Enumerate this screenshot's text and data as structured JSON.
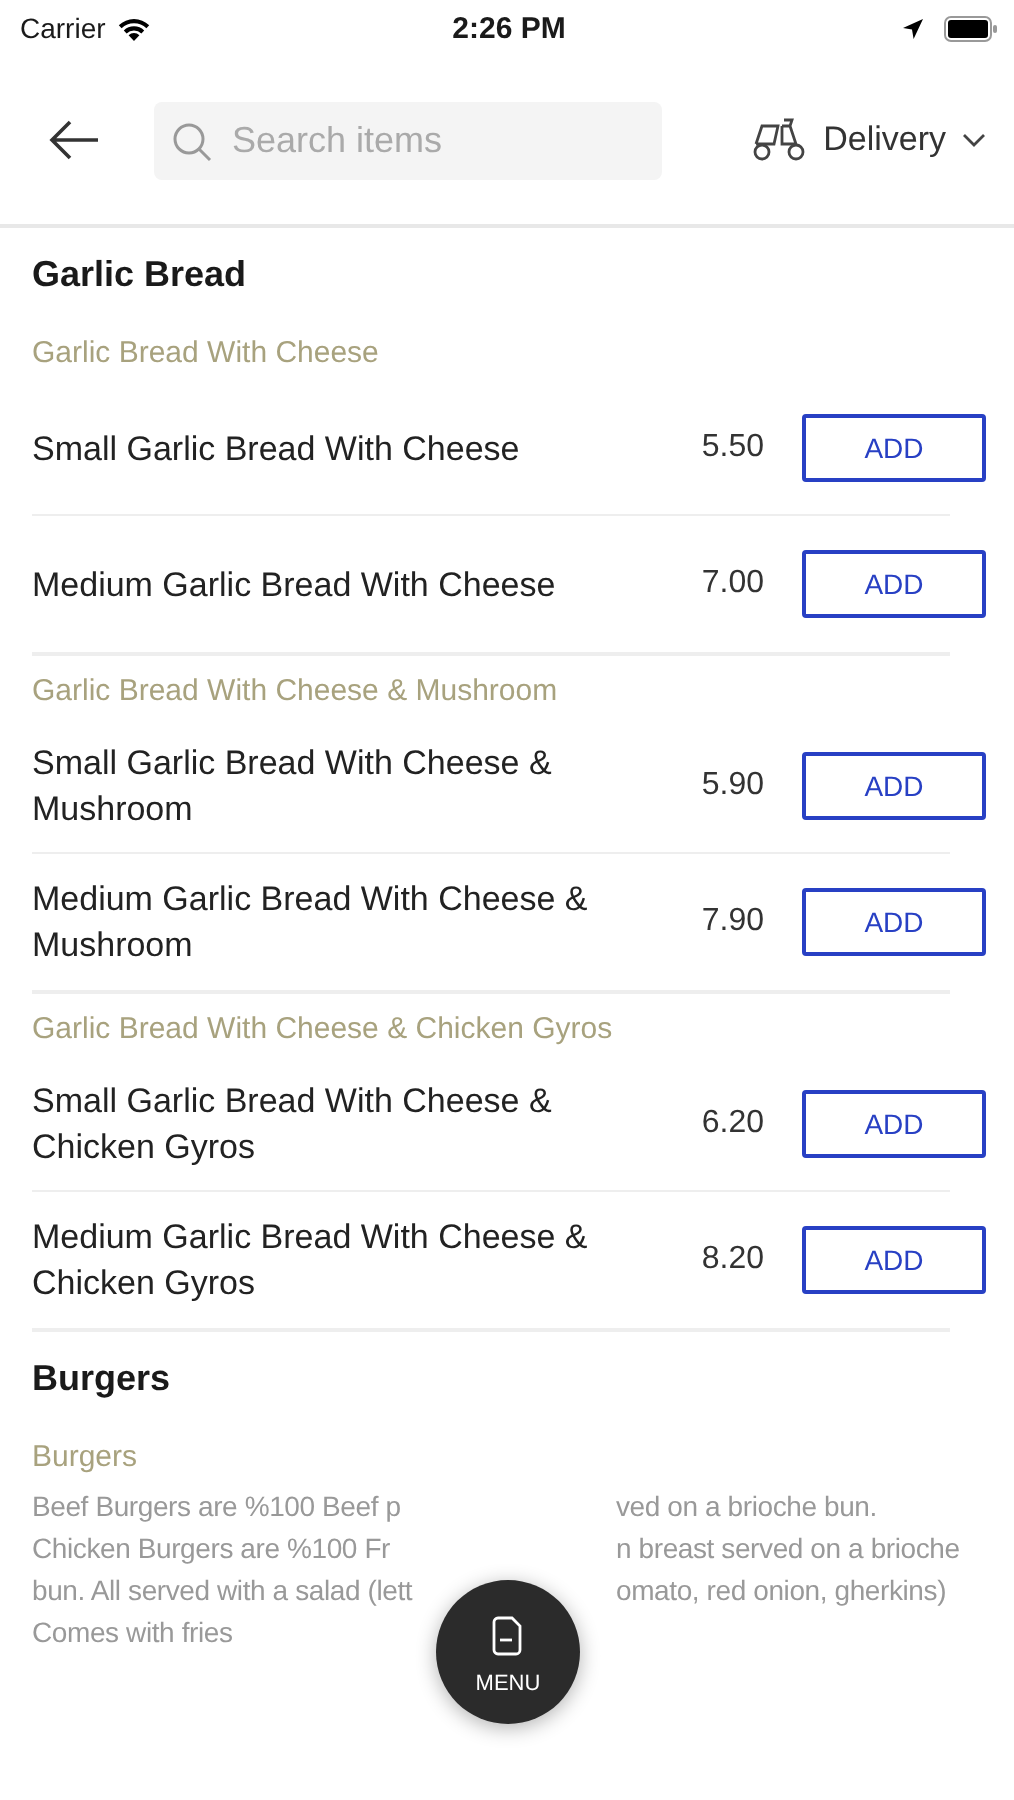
{
  "status_bar": {
    "carrier": "Carrier",
    "time": "2:26 PM"
  },
  "header": {
    "search": {
      "placeholder": "Search items"
    },
    "mode": "Delivery"
  },
  "sections": [
    {
      "title": "Garlic Bread",
      "groups": [
        {
          "name": "Garlic Bread With Cheese",
          "items": [
            {
              "name": "Small Garlic Bread With Cheese",
              "price": "5.50",
              "action": "ADD"
            },
            {
              "name": "Medium Garlic Bread With Cheese",
              "price": "7.00",
              "action": "ADD"
            }
          ]
        },
        {
          "name": "Garlic Bread With Cheese & Mushroom",
          "items": [
            {
              "name": "Small Garlic Bread With Cheese & Mushroom",
              "price": "5.90",
              "action": "ADD"
            },
            {
              "name": "Medium Garlic Bread With Cheese & Mushroom",
              "price": "7.90",
              "action": "ADD"
            }
          ]
        },
        {
          "name": "Garlic Bread With Cheese & Chicken Gyros",
          "items": [
            {
              "name": "Small Garlic Bread With Cheese & Chicken Gyros",
              "price": "6.20",
              "action": "ADD"
            },
            {
              "name": "Medium Garlic Bread With Cheese & Chicken Gyros",
              "price": "8.20",
              "action": "ADD"
            }
          ]
        }
      ]
    },
    {
      "title": "Burgers",
      "groups": [
        {
          "name": "Burgers",
          "description_lines": [
            {
              "left": "Beef Burgers are %100 Beef p",
              "right": "ved on a brioche bun."
            },
            {
              "left": "Chicken Burgers are %100 Fr",
              "right": "n breast served on a brioche"
            },
            {
              "left": "bun. All served with a salad (lett",
              "right": "omato, red onion, gherkins)"
            },
            {
              "left": "Comes with fries"
            }
          ]
        }
      ]
    }
  ],
  "menu_button": {
    "label": "MENU"
  }
}
